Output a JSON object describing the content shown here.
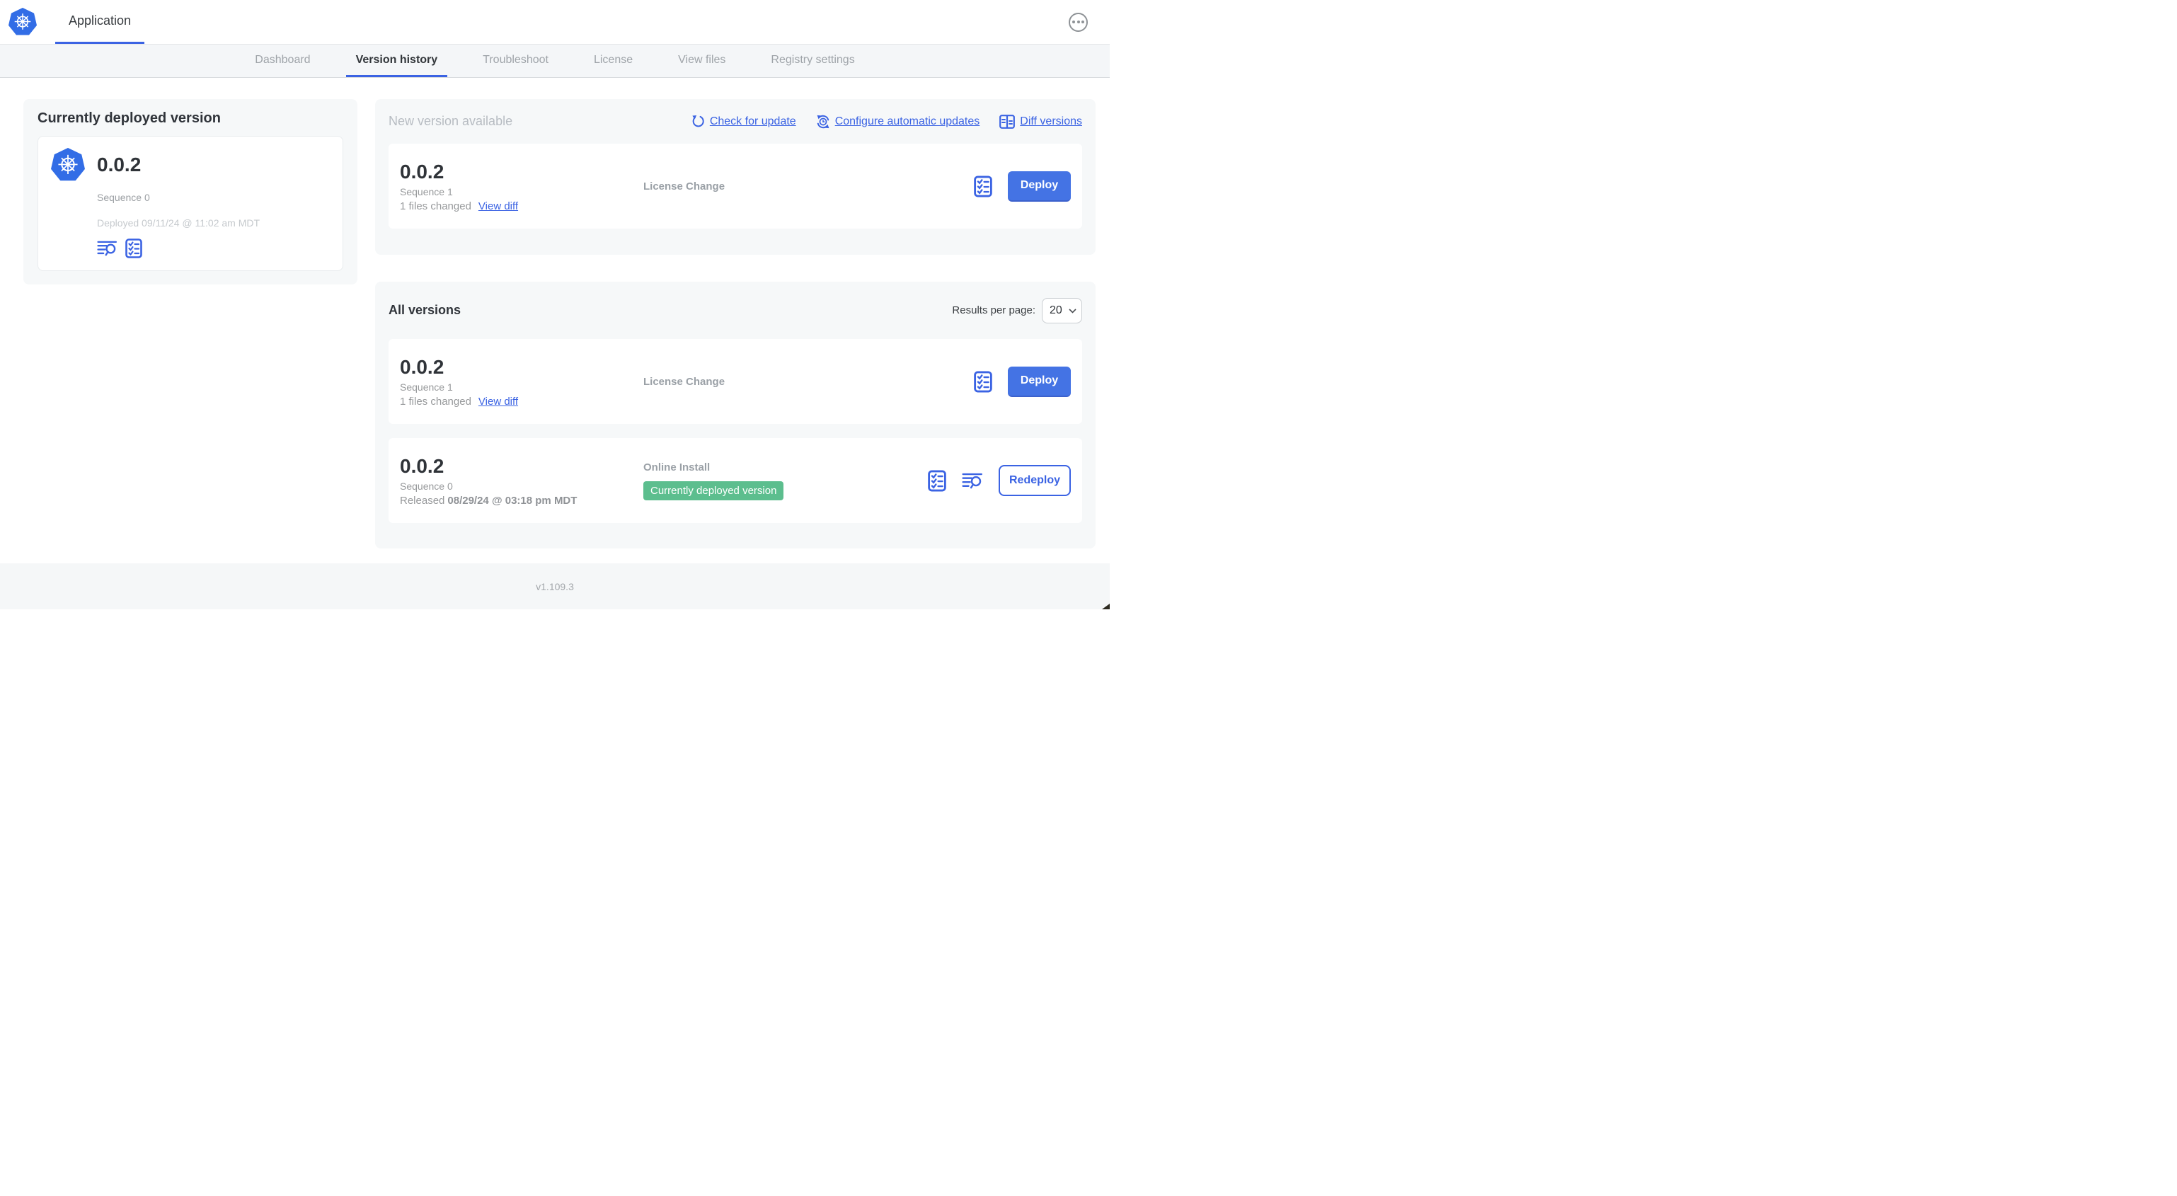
{
  "header": {
    "app_tab_label": "Application"
  },
  "nav": {
    "tabs": [
      "Dashboard",
      "Version history",
      "Troubleshoot",
      "License",
      "View files",
      "Registry settings"
    ],
    "active_tab": "Version history"
  },
  "current_version": {
    "title": "Currently deployed version",
    "version": "0.0.2",
    "sequence": "Sequence 0",
    "deployed": "Deployed 09/11/24 @ 11:02 am MDT"
  },
  "new_version": {
    "title": "New version available",
    "check_for_update": "Check for update",
    "configure_automatic_updates": "Configure automatic updates",
    "diff_versions": "Diff versions",
    "card": {
      "version": "0.0.2",
      "sequence": "Sequence 1",
      "files_changed": "1 files changed",
      "view_diff": "View diff",
      "source": "License Change",
      "action": "Deploy"
    }
  },
  "all_versions": {
    "title": "All versions",
    "results_per_page_label": "Results per page:",
    "results_per_page": "20",
    "rows": [
      {
        "version": "0.0.2",
        "sequence": "Sequence 1",
        "files_changed": "1 files changed",
        "view_diff": "View diff",
        "source": "License Change",
        "action": "Deploy"
      },
      {
        "version": "0.0.2",
        "sequence": "Sequence 0",
        "released_prefix": "Released",
        "released_date": "08/29/24 @ 03:18 pm MDT",
        "source": "Online Install",
        "badge": "Currently deployed version",
        "action": "Redeploy"
      }
    ]
  },
  "footer": {
    "app_version": "v1.109.3"
  },
  "colors": {
    "accent_blue": "#3b63e3",
    "button_blue": "#4473e4",
    "badge_green": "#5cbe8e",
    "panel_gray": "#f6f8f9",
    "kubernetes_blue": "#326de6"
  }
}
